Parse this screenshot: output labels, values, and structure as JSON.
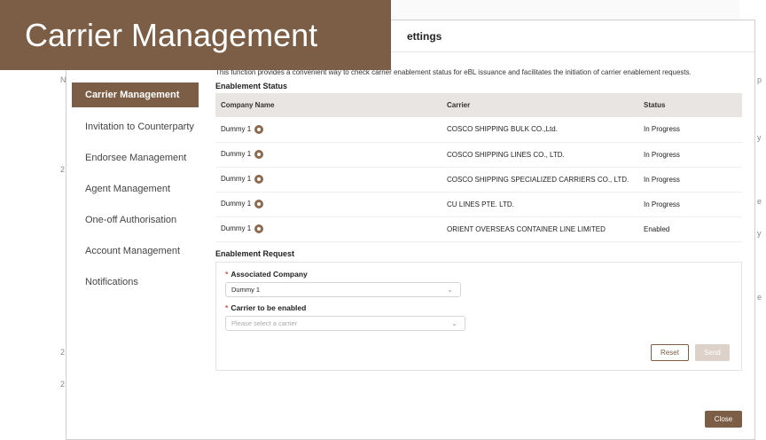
{
  "modal": {
    "title_fragment": "ettings",
    "description": "This function provides a convenient way to check carrier enablement status for eBL issuance and facilitates the initiation of carrier enablement requests."
  },
  "zoom_caption": "Carrier Management",
  "sidebar": {
    "items": [
      {
        "label": "Carrier Management",
        "active": true
      },
      {
        "label": "Invitation to Counterparty"
      },
      {
        "label": "Endorsee Management"
      },
      {
        "label": "Agent Management"
      },
      {
        "label": "One-off Authorisation"
      },
      {
        "label": "Account Management"
      },
      {
        "label": "Notifications"
      }
    ]
  },
  "status_section": {
    "title": "Enablement Status",
    "columns": [
      "Company Name",
      "Carrier",
      "Status"
    ],
    "rows": [
      {
        "company": "Dummy 1",
        "carrier": "COSCO SHIPPING BULK CO.,Ltd.",
        "status": "In Progress"
      },
      {
        "company": "Dummy 1",
        "carrier": "COSCO SHIPPING LINES CO., LTD.",
        "status": "In Progress"
      },
      {
        "company": "Dummy 1",
        "carrier": "COSCO SHIPPING SPECIALIZED CARRIERS CO., LTD.",
        "status": "In Progress"
      },
      {
        "company": "Dummy 1",
        "carrier": "CU LINES PTE. LTD.",
        "status": "In Progress"
      },
      {
        "company": "Dummy 1",
        "carrier": "ORIENT OVERSEAS CONTAINER LINE LIMITED",
        "status": "Enabled"
      }
    ]
  },
  "request_section": {
    "title": "Enablement Request",
    "associated_company_label": "Associated Company",
    "associated_company_value": "Dummy 1",
    "carrier_label": "Carrier to be enabled",
    "carrier_placeholder": "Please select a carrier",
    "reset_label": "Reset",
    "send_label": "Send"
  },
  "close_label": "Close",
  "background_marks": {
    "left": [
      "N",
      "2",
      "2",
      "2"
    ],
    "right": [
      "p",
      "y",
      "e",
      "y",
      "e"
    ]
  },
  "colors": {
    "brand": "#7b5e45",
    "send_disabled": "#dcd2c9",
    "required": "#d9534f"
  }
}
